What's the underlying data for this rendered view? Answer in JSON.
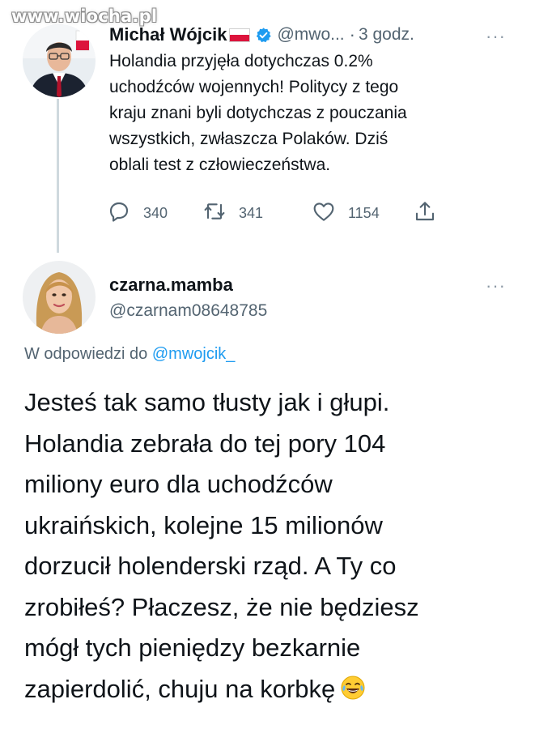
{
  "watermark": "www.wiocha.pl",
  "tweet": {
    "author_name": "Michał Wójcik",
    "handle": "@mwo...",
    "separator": "·",
    "time": "3 godz.",
    "more": "···",
    "lines": [
      "Holandia przyjęła dotychczas 0.2%",
      "uchodźców wojennych! Politycy z tego",
      "kraju znani byli dotychczas z pouczania",
      "wszystkich, zwłaszcza Polaków. Dziś",
      "oblali test z człowieczeństwa."
    ],
    "replies": "340",
    "retweets": "341",
    "likes": "1154"
  },
  "reply": {
    "author_name": "czarna.mamba",
    "handle": "@czarnam08648785",
    "more": "···",
    "replying_prefix": "W odpowiedzi do",
    "replying_mention": "@mwojcik_",
    "lines": [
      "Jesteś tak samo tłusty jak i głupi.",
      "Holandia zebrała do tej pory 104",
      "miliony euro dla uchodźców",
      "ukraińskich, kolejne 15 milionów",
      "dorzucił holenderski rząd. A Ty co",
      "zrobiłeś? Płaczesz, że nie będziesz",
      "mógł tych pieniędzy bezkarnie",
      "zapierdolić, chuju na korbkę"
    ],
    "emoji": "face-with-tears-of-joy"
  },
  "colors": {
    "text": "#0f1419",
    "secondary": "#536471",
    "accent": "#1d9bf0",
    "thread_line": "#cfd9de"
  }
}
